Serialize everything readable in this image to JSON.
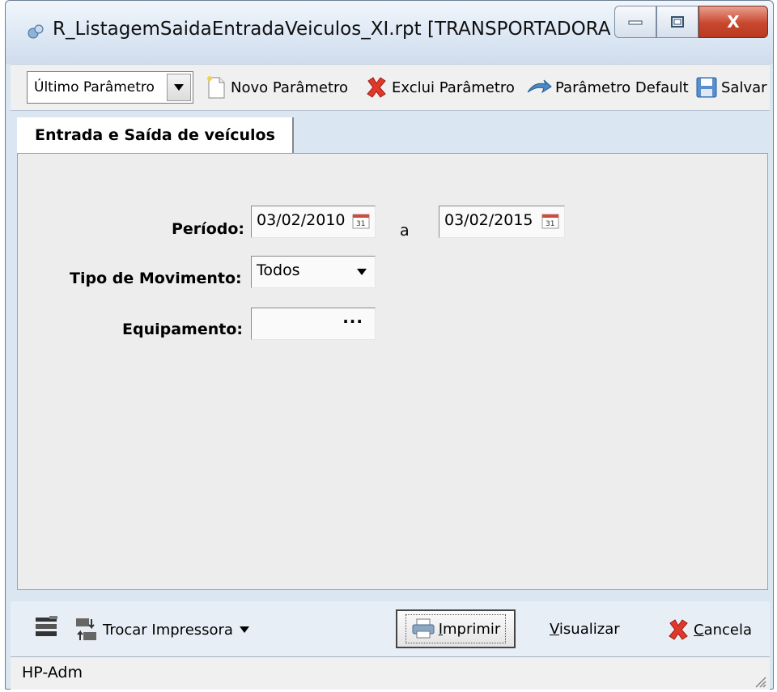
{
  "window": {
    "title": "R_ListagemSaidaEntradaVeiculos_XI.rpt [TRANSPORTADORA NORT...",
    "close_symbol": "X"
  },
  "toolbar": {
    "param_select": "Último Parâmetro",
    "new_param": "Novo Parâmetro",
    "delete_param": "Exclui Parâmetro",
    "default_param": "Parâmetro Default",
    "save": "Salvar"
  },
  "tabs": [
    {
      "label": "Entrada e Saída de veículos",
      "active": true
    }
  ],
  "form": {
    "periodo_label": "Período:",
    "date_from": "03/02/2010",
    "range_sep": "a",
    "date_to": "03/02/2015",
    "tipo_label": "Tipo de Movimento:",
    "tipo_value": "Todos",
    "equip_label": "Equipamento:",
    "equip_value": "",
    "equip_button": "···"
  },
  "bottom": {
    "change_printer": "Trocar Impressora",
    "print_label": "Imprimir",
    "print_underline": "I",
    "print_rest": "mprimir",
    "view_underline": "V",
    "view_rest": "isualizar",
    "cancel_underline": "C",
    "cancel_rest": "ancela"
  },
  "status": {
    "text": "HP-Adm"
  },
  "icons": {
    "app": "report-gear-icon",
    "new": "new-document-icon",
    "delete": "red-x-icon",
    "default": "blue-arrow-icon",
    "save": "floppy-disk-icon",
    "calendar": "calendar-icon",
    "printer_setup": "printer-setup-icon",
    "swap_printer": "swap-printer-icon",
    "print": "printer-icon",
    "cancel": "red-x-icon"
  }
}
